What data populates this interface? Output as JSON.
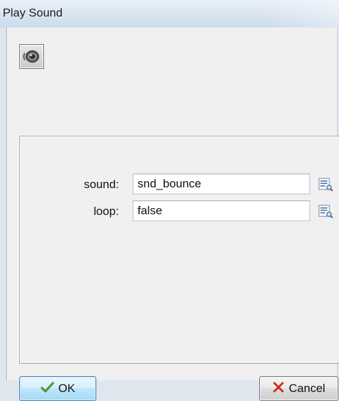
{
  "window": {
    "title": "Play Sound"
  },
  "action": {
    "icon": "speaker-icon"
  },
  "params": [
    {
      "label": "sound:",
      "value": "snd_bounce",
      "button_icon": "list-search-icon"
    },
    {
      "label": "loop:",
      "value": "false",
      "button_icon": "list-search-icon"
    }
  ],
  "footer": {
    "ok_label": "OK",
    "cancel_label": "Cancel"
  },
  "colors": {
    "ok_accent": "#3c7fb1",
    "check": "#4a9d2f",
    "cancel_x": "#d42a1a"
  }
}
